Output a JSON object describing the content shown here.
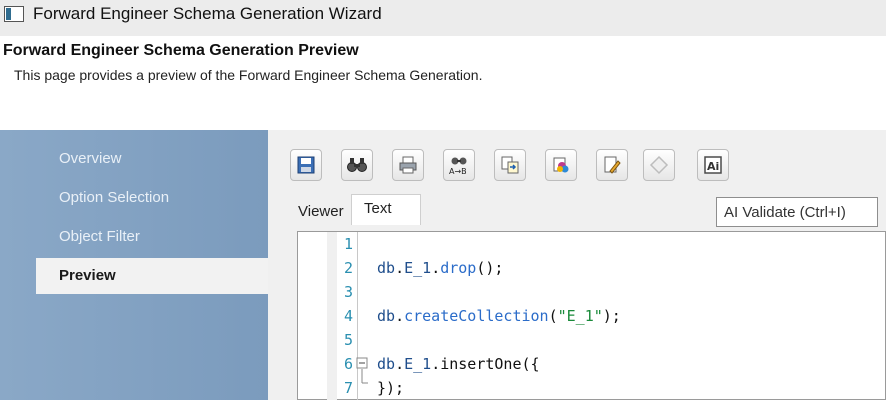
{
  "window": {
    "title": "Forward Engineer Schema Generation Wizard"
  },
  "header": {
    "heading": "Forward Engineer Schema Generation Preview",
    "description": "This page provides a preview of the Forward Engineer Schema Generation."
  },
  "sidebar": {
    "steps": [
      {
        "label": "Overview",
        "active": false
      },
      {
        "label": "Option Selection",
        "active": false
      },
      {
        "label": "Object Filter",
        "active": false
      },
      {
        "label": "Preview",
        "active": true
      }
    ]
  },
  "toolbar": {
    "buttons": [
      {
        "icon": "save-icon"
      },
      {
        "icon": "find-icon"
      },
      {
        "icon": "print-icon"
      },
      {
        "icon": "find-replace-icon"
      },
      {
        "icon": "copy-icon"
      },
      {
        "icon": "color-icon"
      },
      {
        "icon": "edit-icon"
      },
      {
        "icon": "validate-icon"
      },
      {
        "icon": "ai-icon"
      }
    ]
  },
  "tabs": {
    "viewer": "Viewer",
    "text": "Text"
  },
  "tooltip": {
    "text": "AI Validate (Ctrl+I)"
  },
  "editor": {
    "line_numbers": [
      "1",
      "2",
      "3",
      "4",
      "5",
      "6",
      "7"
    ],
    "lines": {
      "l2": {
        "obj": "db",
        "dot1": ".",
        "prop": "E_1",
        "dot2": ".",
        "fn": "drop",
        "tail": "();"
      },
      "l4": {
        "obj": "db",
        "dot1": ".",
        "fn": "createCollection",
        "open": "(",
        "str": "\"E_1\"",
        "tail": ");"
      },
      "l6": {
        "obj": "db",
        "dot1": ".",
        "prop": "E_1",
        "dot2": ".",
        "fn": "insertOne",
        "tail": "({"
      },
      "l7": {
        "tail": "});"
      }
    }
  },
  "colors": {
    "sidebar": "#7b9bbd",
    "line_number": "#2a8fb0",
    "keyword": "#2b6cc9",
    "string": "#1a8a3a"
  }
}
